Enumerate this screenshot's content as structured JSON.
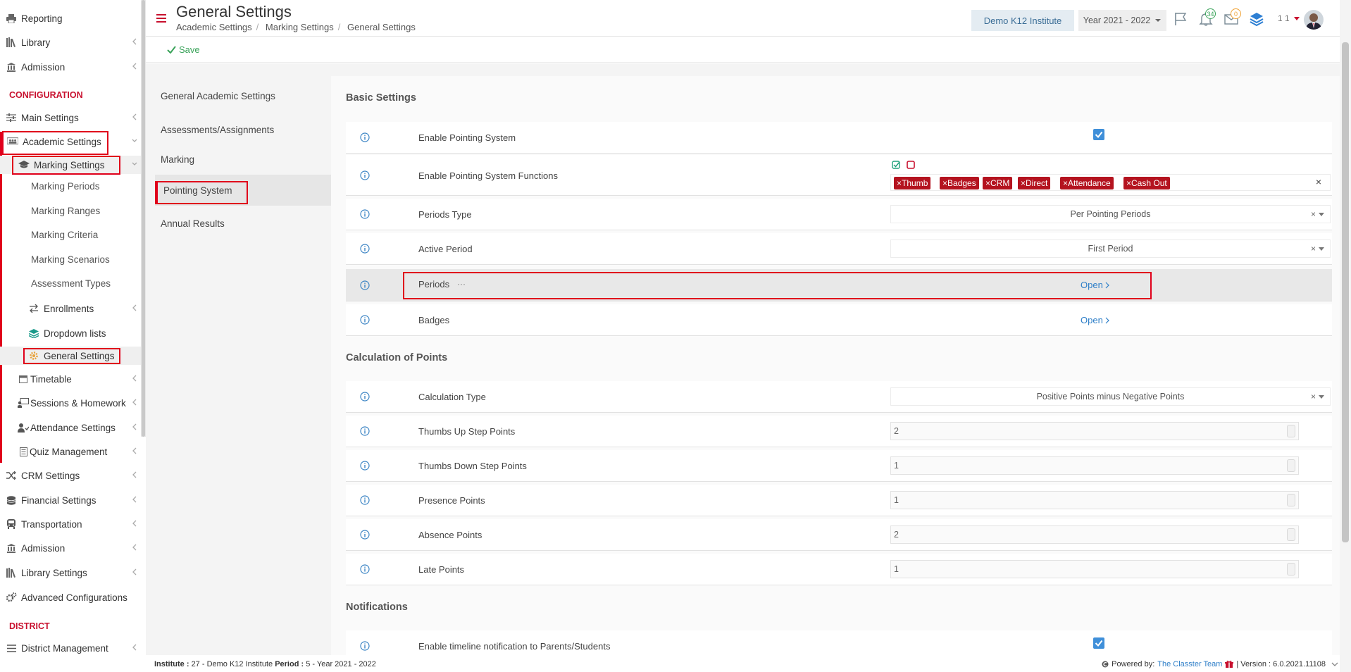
{
  "sidebar": {
    "items_top": [
      {
        "label": "Reporting",
        "icon": "printer-icon"
      },
      {
        "label": "Library",
        "icon": "books-icon"
      },
      {
        "label": "Admission",
        "icon": "institution-icon"
      }
    ],
    "config_title": "CONFIGURATION",
    "main_settings": "Main Settings",
    "academic_settings": "Academic Settings",
    "marking_settings": "Marking Settings",
    "marking_sub": [
      "Marking Periods",
      "Marking Ranges",
      "Marking Criteria",
      "Marking Scenarios",
      "Assessment Types"
    ],
    "enrollments": "Enrollments",
    "dropdown_lists": "Dropdown lists",
    "general_settings": "General Settings",
    "timetable": "Timetable",
    "sessions_homework": "Sessions & Homework",
    "attendance_settings": "Attendance Settings",
    "quiz_management": "Quiz Management",
    "crm_settings": "CRM Settings",
    "financial_settings": "Financial Settings",
    "transportation": "Transportation",
    "admission2": "Admission",
    "library_settings": "Library Settings",
    "advanced_configurations": "Advanced Configurations",
    "district_title": "DISTRICT",
    "district_management": "District Management"
  },
  "header": {
    "title": "General Settings",
    "breadcrumb": [
      "Academic Settings",
      "Marking Settings",
      "General Settings"
    ],
    "institute": "Demo K12 Institute",
    "year": "Year 2021 - 2022",
    "notif_count": "34",
    "mail_count": "0",
    "user_number": "1 1"
  },
  "toolbar": {
    "save_label": "Save"
  },
  "tabs": [
    "General Academic Settings",
    "Assessments/Assignments",
    "Marking",
    "Pointing System",
    "Annual Results"
  ],
  "basic": {
    "title": "Basic Settings",
    "enable_pointing": "Enable Pointing System",
    "enable_functions": "Enable Pointing System Functions",
    "function_tags": [
      "Thumb",
      "Badges",
      "CRM",
      "Direct",
      "Attendance",
      "Cash Out"
    ],
    "periods_type_label": "Periods Type",
    "periods_type_value": "Per Pointing Periods",
    "active_period_label": "Active Period",
    "active_period_value": "First Period",
    "periods_label": "Periods",
    "periods_dots": "···",
    "badges_label": "Badges",
    "open_label": "Open"
  },
  "calc": {
    "title": "Calculation of Points",
    "type_label": "Calculation Type",
    "type_value": "Positive Points minus Negative Points",
    "thumbs_up_label": "Thumbs Up Step Points",
    "thumbs_up_value": "2",
    "thumbs_down_label": "Thumbs Down Step Points",
    "thumbs_down_value": "1",
    "presence_label": "Presence Points",
    "presence_value": "1",
    "absence_label": "Absence Points",
    "absence_value": "2",
    "late_label": "Late Points",
    "late_value": "1"
  },
  "notifications": {
    "title": "Notifications",
    "timeline_label": "Enable timeline notification to Parents/Students"
  },
  "footer": {
    "institute_label": "Institute :",
    "institute_value": "27 - Demo K12 Institute",
    "period_label": "Period :",
    "period_value": "5 - Year 2021 - 2022",
    "powered": "Powered by:",
    "team": "The Classter Team",
    "version": "| Version : 6.0.2021.11108"
  },
  "colors": {
    "accent_red": "#e0001b",
    "tag_red": "#b4131f",
    "link_blue": "#2f7fc8",
    "save_green": "#3aa35a"
  }
}
